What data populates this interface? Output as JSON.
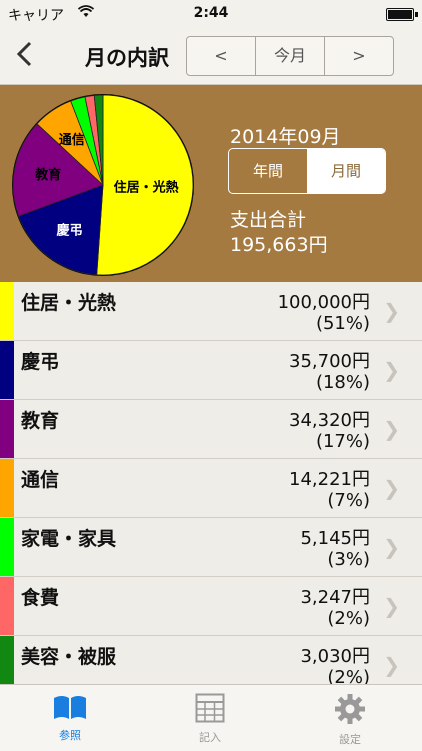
{
  "status_bar": {
    "carrier": "キャリア",
    "time": "2:44"
  },
  "nav": {
    "title": "月の内訳",
    "prev_label": "<",
    "current_label": "今月",
    "next_label": ">"
  },
  "summary": {
    "month": "2014年09月",
    "period_year": "年間",
    "period_month": "月間",
    "selected_period": "月間",
    "total_label": "支出合計",
    "total_value": "195,663円"
  },
  "chart_data": {
    "type": "pie",
    "total": 195663,
    "slices": [
      {
        "label": "住居・光熱",
        "value": 100000,
        "percent": 51,
        "color": "#ffff00"
      },
      {
        "label": "慶弔",
        "value": 35700,
        "percent": 18,
        "color": "#000080"
      },
      {
        "label": "教育",
        "value": 34320,
        "percent": 17,
        "color": "#800080"
      },
      {
        "label": "通信",
        "value": 14221,
        "percent": 7,
        "color": "#ffa500"
      },
      {
        "label": "家電・家具",
        "value": 5145,
        "percent": 3,
        "color": "#00ff00"
      },
      {
        "label": "食費",
        "value": 3247,
        "percent": 2,
        "color": "#ff6666"
      },
      {
        "label": "美容・被服",
        "value": 3030,
        "percent": 2,
        "color": "#118811"
      }
    ],
    "labeled_slices": [
      {
        "label": "住居・光熱",
        "text_color": "#000000"
      },
      {
        "label": "慶弔",
        "text_color": "#ffffff"
      },
      {
        "label": "教育",
        "text_color": "#000000"
      },
      {
        "label": "通信",
        "text_color": "#000000"
      }
    ]
  },
  "categories": [
    {
      "name": "住居・光熱",
      "amount": "100,000円",
      "percent": "(51%)",
      "color": "#ffff00"
    },
    {
      "name": "慶弔",
      "amount": "35,700円",
      "percent": "(18%)",
      "color": "#000080"
    },
    {
      "name": "教育",
      "amount": "34,320円",
      "percent": "(17%)",
      "color": "#800080"
    },
    {
      "name": "通信",
      "amount": "14,221円",
      "percent": "(7%)",
      "color": "#ffa500"
    },
    {
      "name": "家電・家具",
      "amount": "5,145円",
      "percent": "(3%)",
      "color": "#00ff00"
    },
    {
      "name": "食費",
      "amount": "3,247円",
      "percent": "(2%)",
      "color": "#ff6666"
    },
    {
      "name": "美容・被服",
      "amount": "3,030円",
      "percent": "(2%)",
      "color": "#118811"
    }
  ],
  "tabs": [
    {
      "label": "参照",
      "icon": "book-icon",
      "active": true
    },
    {
      "label": "記入",
      "icon": "grid-icon",
      "active": false
    },
    {
      "label": "設定",
      "icon": "gear-icon",
      "active": false
    }
  ],
  "colors": {
    "panel_bg": "#a47a40",
    "active_tab": "#1a7de0",
    "inactive_tab": "#999999"
  }
}
